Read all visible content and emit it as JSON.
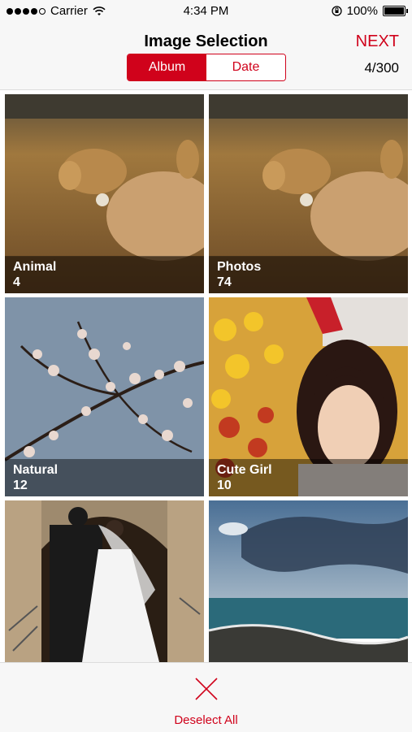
{
  "status_bar": {
    "carrier": "Carrier",
    "time": "4:34 PM",
    "battery": "100%"
  },
  "nav": {
    "title": "Image Selection",
    "next_label": "NEXT",
    "selection_count": "4/300"
  },
  "segmented": {
    "album_label": "Album",
    "date_label": "Date",
    "selected": "Album"
  },
  "albums": [
    {
      "name": "Animal",
      "count": "4",
      "image": "deer-photo"
    },
    {
      "name": "Photos",
      "count": "74",
      "image": "deer-photo"
    },
    {
      "name": "Natural",
      "count": "12",
      "image": "cherry-blossom-photo"
    },
    {
      "name": "Cute Girl",
      "count": "10",
      "image": "portrait-photo"
    },
    {
      "name": "",
      "count": "",
      "image": "wedding-photo"
    },
    {
      "name": "",
      "count": "",
      "image": "seascape-photo"
    }
  ],
  "bottom": {
    "deselect_label": "Deselect All"
  },
  "colors": {
    "accent": "#d0021b"
  }
}
